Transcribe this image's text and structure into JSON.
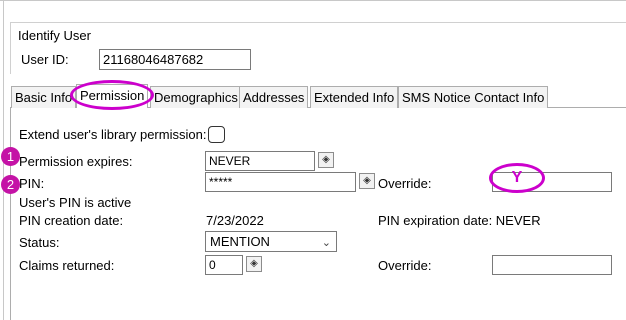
{
  "identify": {
    "title": "Identify User",
    "user_id_label": "User ID:",
    "user_id_value": "21168046487682"
  },
  "tabs": [
    {
      "label": "Basic Info",
      "active": false
    },
    {
      "label": "Permission",
      "active": true
    },
    {
      "label": "Demographics",
      "active": false
    },
    {
      "label": "Addresses",
      "active": false
    },
    {
      "label": "Extended Info",
      "active": false
    },
    {
      "label": "SMS Notice Contact Info",
      "active": false
    }
  ],
  "permission": {
    "extend_label": "Extend user's library permission:",
    "expires_label": "Permission expires:",
    "expires_value": "NEVER",
    "pin_label": "PIN:",
    "pin_value": "*****",
    "override_label": "Override:",
    "override_value": "Y",
    "pin_active_text": "User's PIN is active",
    "pin_creation_label": "PIN creation date:",
    "pin_creation_value": "7/23/2022",
    "pin_expiration_text": "PIN expiration date: NEVER",
    "status_label": "Status:",
    "status_value": "MENTION",
    "claims_label": "Claims returned:",
    "claims_value": "0",
    "override2_label": "Override:",
    "override2_value": ""
  },
  "annotations": {
    "badge1": "1",
    "badge2": "2"
  },
  "icons": {
    "gadget": "diamond-gadget-icon",
    "dropdown": "chevron-down-icon"
  },
  "colors": {
    "highlight": "#cc00cc",
    "badge": "#c413a6"
  }
}
